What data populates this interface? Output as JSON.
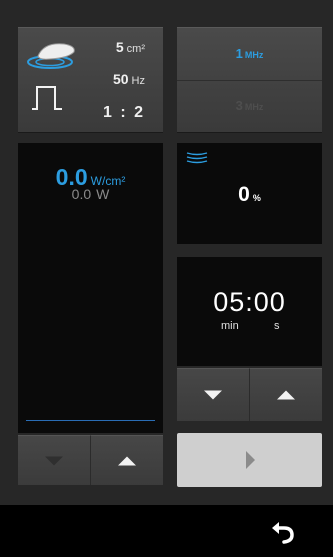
{
  "settings": {
    "area_value": "5",
    "area_unit": "cm²",
    "frequency_value": "50",
    "frequency_unit": "Hz",
    "duty_ratio": "1 : 2"
  },
  "frequency": {
    "option1_value": "1",
    "option1_unit": "MHz",
    "option2_value": "3",
    "option2_unit": "MHz",
    "selected": "1 MHz",
    "accent_color": "#2c9de0",
    "disabled_color": "#4e4e4e"
  },
  "intensity": {
    "power_density": "0.0",
    "power_density_unit": "W/cm²",
    "power": "0.0",
    "power_unit": "W"
  },
  "output": {
    "value": "0",
    "unit": "%"
  },
  "timer": {
    "value": "05:00",
    "min_label": "min",
    "sec_label": "s"
  },
  "icons": {
    "head": "transducer-head-icon",
    "waveform": "pulse-waveform-icon",
    "output": "wave-lines-icon",
    "play": "play-icon",
    "back": "back-arrow-icon"
  }
}
